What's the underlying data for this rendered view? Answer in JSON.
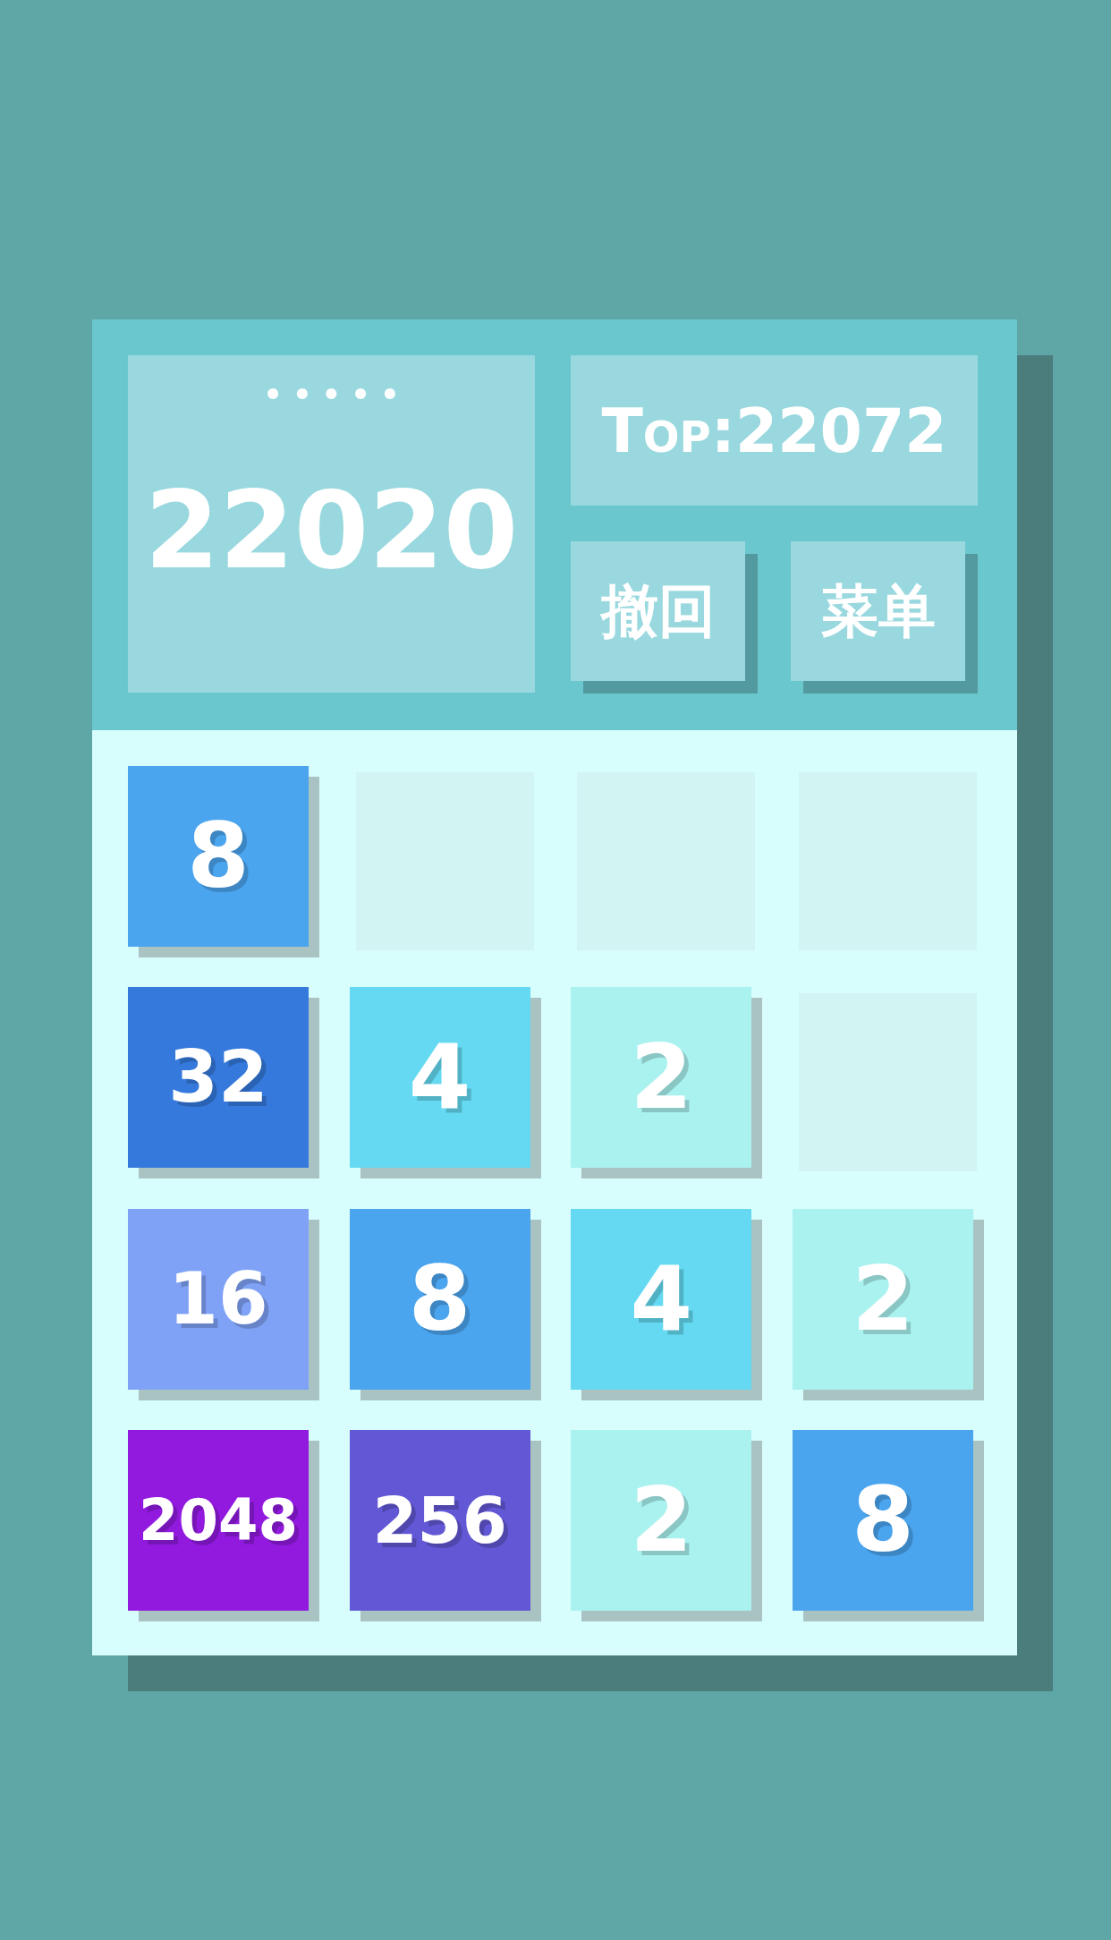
{
  "score_panel": {
    "label": "•••••",
    "score": "22020"
  },
  "best_score": {
    "text": "Top:22072"
  },
  "buttons": [
    {
      "label": "撤回"
    },
    {
      "label": "菜单"
    }
  ],
  "board": {
    "rows": [
      [
        {
          "kind": "tile",
          "value": "8",
          "color": "#4aa4ee"
        },
        {
          "kind": "empty"
        },
        {
          "kind": "empty"
        },
        {
          "kind": "empty"
        }
      ],
      [
        {
          "kind": "tile",
          "value": "32",
          "color": "#3579dc"
        },
        {
          "kind": "tile",
          "value": "4",
          "color": "#64d9f1"
        },
        {
          "kind": "tile",
          "value": "2",
          "color": "#a9f2f0"
        },
        {
          "kind": "empty"
        }
      ],
      [
        {
          "kind": "tile",
          "value": "16",
          "color": "#7fa2f6"
        },
        {
          "kind": "tile",
          "value": "8",
          "color": "#4aa4ee"
        },
        {
          "kind": "tile",
          "value": "4",
          "color": "#64d9f1"
        },
        {
          "kind": "tile",
          "value": "2",
          "color": "#a9f2f0"
        }
      ],
      [
        {
          "kind": "tile",
          "value": "2048",
          "color": "#911ade"
        },
        {
          "kind": "tile",
          "value": "256",
          "color": "#6257d4"
        },
        {
          "kind": "tile",
          "value": "2",
          "color": "#a9f2f0"
        },
        {
          "kind": "tile",
          "value": "8",
          "color": "#4aa4ee"
        }
      ]
    ]
  }
}
